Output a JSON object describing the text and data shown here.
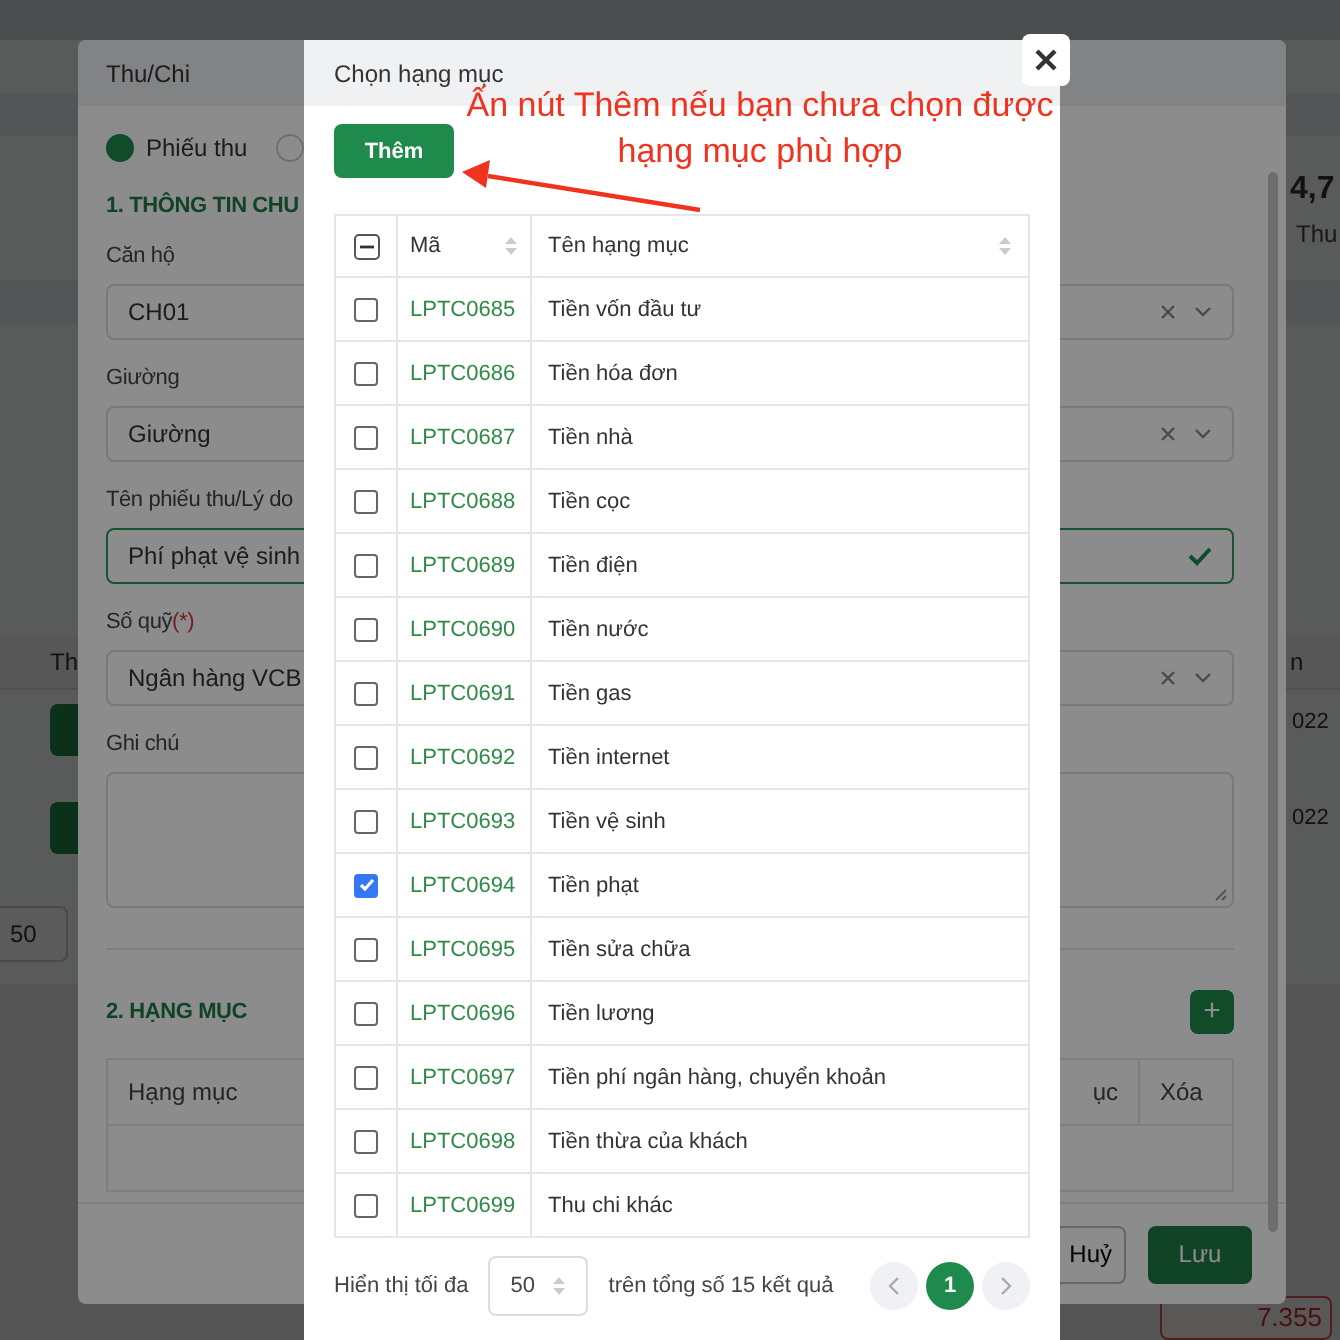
{
  "background_page": {
    "summary_value": "4,7",
    "summary_label": "Thu",
    "left_column_header": "Th",
    "right_column_header": "n",
    "row_dates": [
      "022",
      "022"
    ],
    "page_size": "50",
    "balance": "7.355"
  },
  "form_dialog": {
    "title": "Thu/Chi",
    "voucher_types": [
      {
        "label": "Phiếu thu",
        "selected": true
      },
      {
        "selected": false
      }
    ],
    "section_1": "1. THÔNG TIN CHU",
    "fields": [
      {
        "kind": "select",
        "label": "Căn hộ",
        "value": "CH01"
      },
      {
        "kind": "select",
        "label": "Giường",
        "value": "Giường"
      },
      {
        "kind": "input",
        "label": "Tên phiếu thu/Lý do",
        "value": "Phí phạt vệ sinh",
        "valid": true
      },
      {
        "kind": "select",
        "label": "Số quỹ",
        "required_mark": "(*)",
        "value": "Ngân hàng VCB"
      },
      {
        "kind": "textarea",
        "label": "Ghi chú"
      }
    ],
    "section_2": "2. HẠNG MỤC",
    "add_button": "+",
    "items_table": {
      "columns": [
        "Hạng mục",
        "ục",
        "Xóa"
      ]
    },
    "buttons": [
      {
        "label": "Huỷ",
        "kind": "secondary"
      },
      {
        "label": "Lưu",
        "kind": "primary"
      }
    ]
  },
  "category_picker": {
    "title": "Chọn hạng mục",
    "add_button": "Thêm",
    "annotation": "Ấn nút Thêm nếu bạn chưa chọn được hạng mục phù hợp",
    "table": {
      "select_all_partial": true,
      "columns": [
        "Mã",
        "Tên hạng mục"
      ],
      "rows": [
        {
          "code": "LPTC0685",
          "name": "Tiền vốn đầu tư",
          "checked": false
        },
        {
          "code": "LPTC0686",
          "name": "Tiền hóa đơn",
          "checked": false
        },
        {
          "code": "LPTC0687",
          "name": "Tiền nhà",
          "checked": false
        },
        {
          "code": "LPTC0688",
          "name": "Tiền cọc",
          "checked": false
        },
        {
          "code": "LPTC0689",
          "name": "Tiền điện",
          "checked": false
        },
        {
          "code": "LPTC0690",
          "name": "Tiền nước",
          "checked": false
        },
        {
          "code": "LPTC0691",
          "name": "Tiền gas",
          "checked": false
        },
        {
          "code": "LPTC0692",
          "name": "Tiền internet",
          "checked": false
        },
        {
          "code": "LPTC0693",
          "name": "Tiền vệ sinh",
          "checked": false
        },
        {
          "code": "LPTC0694",
          "name": "Tiền phạt",
          "checked": true
        },
        {
          "code": "LPTC0695",
          "name": "Tiền sửa chữa",
          "checked": false
        },
        {
          "code": "LPTC0696",
          "name": "Tiền lương",
          "checked": false
        },
        {
          "code": "LPTC0697",
          "name": "Tiền phí ngân hàng, chuyển khoản",
          "checked": false
        },
        {
          "code": "LPTC0698",
          "name": "Tiền thừa của khách",
          "checked": false
        },
        {
          "code": "LPTC0699",
          "name": "Thu chi khác",
          "checked": false
        }
      ]
    },
    "footer": {
      "show_label": "Hiển thị tối đa",
      "page_size": "50",
      "total": "trên tổng số 15 kết quả",
      "pages": [
        {
          "label": "1",
          "selected": true
        }
      ]
    }
  }
}
